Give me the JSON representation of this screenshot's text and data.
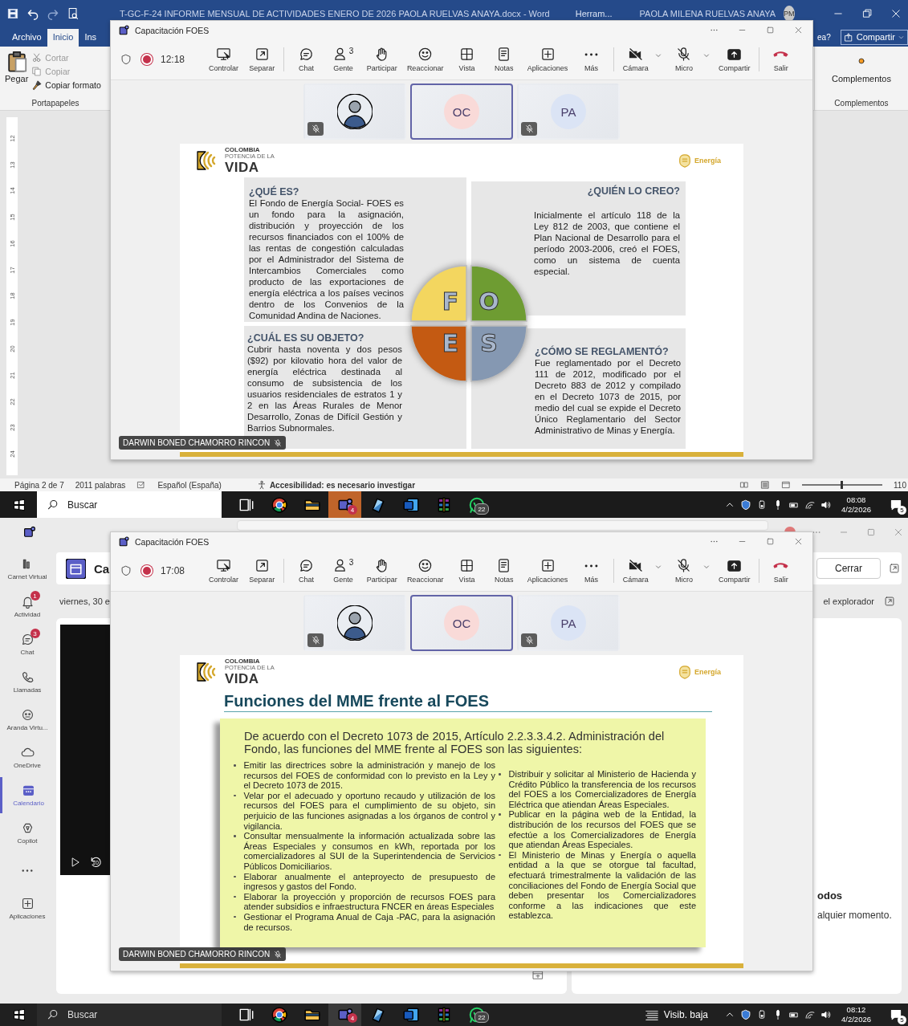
{
  "screens": [
    {
      "kind": "word",
      "title": "T-GC-F-24 INFORME MENSUAL DE ACTIVIDADES ENERO DE 2026 PAOLA RUELVAS ANAYA.docx  -  Word",
      "tools_tab": "Herram...",
      "user_name": "PAOLA MILENA RUELVAS ANAYA",
      "user_initials": "PM",
      "ribbon_tabs": [
        {
          "label": "Archivo",
          "selected": false
        },
        {
          "label": "Inicio",
          "selected": true
        },
        {
          "label": "Ins",
          "selected": false
        }
      ],
      "help_fragment": "ea?",
      "share_button": "Compartir",
      "clipboard": {
        "paste": "Pegar",
        "commands": [
          {
            "label": "Cortar",
            "disabled": true
          },
          {
            "label": "Copiar",
            "disabled": true
          },
          {
            "label": "Copiar formato",
            "disabled": false
          }
        ],
        "group": "Portapapeles"
      },
      "addins": {
        "button": "Complementos",
        "group": "Complementos"
      },
      "ruler_marks": [
        "12",
        "13",
        "14",
        "15",
        "16",
        "17",
        "18",
        "19",
        "20",
        "21",
        "22",
        "23",
        "24"
      ],
      "status_bar": {
        "page": "Página 2 de 7",
        "words": "2011 palabras",
        "language": "Español (España)",
        "accessibility": "Accesibilidad: es necesario investigar",
        "zoom_slider": {
          "level": 0.48
        },
        "zoom": "110"
      },
      "meeting": {
        "title": "Capacitación FOES",
        "recording": true,
        "timer": "12:18",
        "toolbar": [
          {
            "kind": "button",
            "label": "Controlar"
          },
          {
            "kind": "button",
            "label": "Separar"
          },
          {
            "kind": "button",
            "label": "Chat"
          },
          {
            "kind": "button",
            "label": "Gente",
            "count": "3"
          },
          {
            "kind": "button",
            "label": "Participar"
          },
          {
            "kind": "button",
            "label": "Reaccionar"
          },
          {
            "kind": "button",
            "label": "Vista"
          },
          {
            "kind": "button",
            "label": "Notas"
          },
          {
            "kind": "button",
            "label": "Aplicaciones"
          },
          {
            "kind": "button",
            "label": "Más"
          },
          {
            "kind": "menu",
            "label": "Cámara"
          },
          {
            "kind": "menu",
            "label": "Micro"
          },
          {
            "kind": "button",
            "label": "Compartir"
          },
          {
            "kind": "leave",
            "label": "Salir"
          }
        ],
        "participants": [
          {
            "kind": "photo",
            "speaking": false,
            "muted": true
          },
          {
            "kind": "initials",
            "initials": "OC",
            "color": "#f9dad8",
            "speaking": true,
            "muted": false
          },
          {
            "kind": "initials",
            "initials": "PA",
            "color": "#dbe4f5",
            "speaking": false,
            "muted": true
          }
        ],
        "presenter": {
          "name": "DARWIN BONED CHAMORRO RINCON",
          "muted": true
        },
        "slide": {
          "kind": "quadrants",
          "logo": [
            "COLOMBIA",
            "POTENCIA DE LA",
            "VIDA"
          ],
          "ministry": "Energía",
          "quadrants": [
            {
              "title": "¿QUÉ ES?",
              "text": "El Fondo de Energía Social- FOES es un fondo para la asignación, distribución y proyección de los recursos financiados con el 100% de las rentas de congestión calculadas por el Administrador del Sistema de Intercambios Comerciales como producto de las exportaciones de energía eléctrica a los países vecinos dentro de los Convenios de la Comunidad Andina de Naciones."
            },
            {
              "title": "¿QUIÉN LO CREO?",
              "text": "Inicialmente el artículo 118 de la Ley 812 de 2003, que contiene el Plan Nacional de Desarrollo para el período 2003-2006, creó el FOES, como un sistema de cuenta especial."
            },
            {
              "title": "¿CUÁL ES SU OBJETO?",
              "text": "Cubrir hasta noventa y dos pesos ($92) por kilovatio hora del valor de energía eléctrica destinada al consumo de subsistencia de los usuarios residenciales de estratos 1 y 2 en las Áreas Rurales de Menor Desarrollo, Zonas de Difícil Gestión y Barrios Subnormales."
            },
            {
              "title": "¿CÓMO SE REGLAMENTÓ?",
              "text": "Fue reglamentado por el Decreto 111 de 2012, modificado por el Decreto 883 de 2012 y compilado en el Decreto 1073 de 2015, por medio del cual se expide el Decreto Único Reglamentario del Sector Administrativo de Minas y Energía."
            }
          ],
          "letters": [
            "F",
            "O",
            "E",
            "S"
          ]
        }
      },
      "taskbar": {
        "search": "Buscar",
        "apps": [
          {
            "active": false,
            "flashing": false
          },
          {
            "active": false,
            "flashing": false
          },
          {
            "active": false,
            "flashing": false
          },
          {
            "active": false,
            "flashing": true,
            "badge": "4"
          },
          {
            "active": false,
            "flashing": false
          },
          {
            "active": false,
            "flashing": false
          },
          {
            "active": false,
            "flashing": false
          },
          {
            "active": false,
            "flashing": false,
            "badge": "22"
          }
        ],
        "time": "08:08",
        "date": "4/2/2026",
        "notifications": "5"
      }
    },
    {
      "kind": "teams",
      "sidebar": [
        {
          "kind": "app",
          "label": "Carnet Virtual",
          "selected": false
        },
        {
          "kind": "app",
          "label": "Actividad",
          "badge": "1",
          "selected": false
        },
        {
          "kind": "app",
          "label": "Chat",
          "badge": "3",
          "selected": false
        },
        {
          "kind": "app",
          "label": "Llamadas",
          "selected": false
        },
        {
          "kind": "app",
          "label": "Aranda Virtu...",
          "selected": false
        },
        {
          "kind": "app",
          "label": "OneDrive",
          "selected": false
        },
        {
          "kind": "app",
          "label": "Calendario",
          "selected": true
        },
        {
          "kind": "app",
          "label": "Copilot",
          "selected": false
        },
        {
          "kind": "more",
          "selected": false
        },
        {
          "kind": "app",
          "label": "Aplicaciones",
          "selected": false
        }
      ],
      "header_title": "Ca",
      "close_button": "Cerrar",
      "date_fragment": "viernes, 30 e",
      "browser_link": "el explorador",
      "player_skip": "10",
      "side_heading": "odos",
      "side_text": "alquier momento.",
      "meeting": {
        "title": "Capacitación FOES",
        "recording": true,
        "timer": "17:08",
        "toolbar": [
          {
            "kind": "button",
            "label": "Controlar"
          },
          {
            "kind": "button",
            "label": "Separar"
          },
          {
            "kind": "button",
            "label": "Chat"
          },
          {
            "kind": "button",
            "label": "Gente",
            "count": "3"
          },
          {
            "kind": "button",
            "label": "Participar"
          },
          {
            "kind": "button",
            "label": "Reaccionar"
          },
          {
            "kind": "button",
            "label": "Vista"
          },
          {
            "kind": "button",
            "label": "Notas"
          },
          {
            "kind": "button",
            "label": "Aplicaciones"
          },
          {
            "kind": "button",
            "label": "Más"
          },
          {
            "kind": "menu",
            "label": "Cámara"
          },
          {
            "kind": "menu",
            "label": "Micro"
          },
          {
            "kind": "button",
            "label": "Compartir"
          },
          {
            "kind": "leave",
            "label": "Salir"
          }
        ],
        "participants": [
          {
            "kind": "photo",
            "speaking": false,
            "muted": true
          },
          {
            "kind": "initials",
            "initials": "OC",
            "color": "#f9dad8",
            "speaking": true,
            "muted": false
          },
          {
            "kind": "initials",
            "initials": "PA",
            "color": "#dbe4f5",
            "speaking": false,
            "muted": true
          }
        ],
        "presenter": {
          "name": "DARWIN BONED CHAMORRO RINCON",
          "muted": true
        },
        "slide": {
          "kind": "functions",
          "logo": [
            "COLOMBIA",
            "POTENCIA DE LA",
            "VIDA"
          ],
          "ministry": "Energía",
          "title": "Funciones del MME frente al FOES",
          "intro": "De acuerdo con el Decreto 1073 de 2015, Artículo 2.2.3.3.4.2. Administración del Fondo, las funciones del MME frente al FOES son las siguientes:",
          "columns": [
            [
              "Emitir las directrices sobre la administración y manejo de los recursos del FOES de conformidad con lo previsto en la Ley y el Decreto 1073 de 2015.",
              "Velar por el adecuado y oportuno recaudo y utilización de los recursos del FOES para el cumplimiento de su objeto, sin perjuicio de las funciones asignadas a los órganos de control y vigilancia.",
              "Consultar mensualmente la información actualizada sobre las Áreas Especiales y consumos en kWh, reportada por los comercializadores al SUI de la Superintendencia de Servicios Públicos Domiciliarios.",
              "Elaborar anualmente el anteproyecto de presupuesto de ingresos y gastos del Fondo.",
              "Elaborar la proyección y proporción de recursos FOES para atender subsidios e infraestructura FNCER en áreas Especiales",
              "Gestionar el Programa Anual de Caja -PAC, para la asignación de recursos."
            ],
            [
              "Distribuir y solicitar al Ministerio de Hacienda y Crédito Público la transferencia de los recursos del FOES a los Comercializadores de Energía Eléctrica que atiendan Áreas Especiales.",
              "Publicar en la página web de la Entidad, la distribución de los recursos del FOES que se efectúe a los Comercializadores de Energía que atiendan Áreas Especiales.",
              "El Ministerio de Minas y Energía o aquella entidad a la que se otorgue tal facultad, efectuará trimestralmente la validación de las conciliaciones del Fondo de Energía Social que deben presentar los Comercializadores conforme a las indicaciones que este establezca."
            ]
          ]
        }
      },
      "taskbar": {
        "weather": "Visib. baja",
        "search": "Buscar",
        "apps": [
          {
            "active": false,
            "flashing": false
          },
          {
            "active": false,
            "flashing": false
          },
          {
            "active": false,
            "flashing": false
          },
          {
            "active": true,
            "flashing": false,
            "badge": "4"
          },
          {
            "active": false,
            "flashing": false
          },
          {
            "active": false,
            "flashing": false
          },
          {
            "active": false,
            "flashing": false
          },
          {
            "active": false,
            "flashing": false,
            "badge": "22"
          }
        ],
        "time": "08:12",
        "date": "4/2/2026",
        "notifications": "5"
      }
    }
  ]
}
